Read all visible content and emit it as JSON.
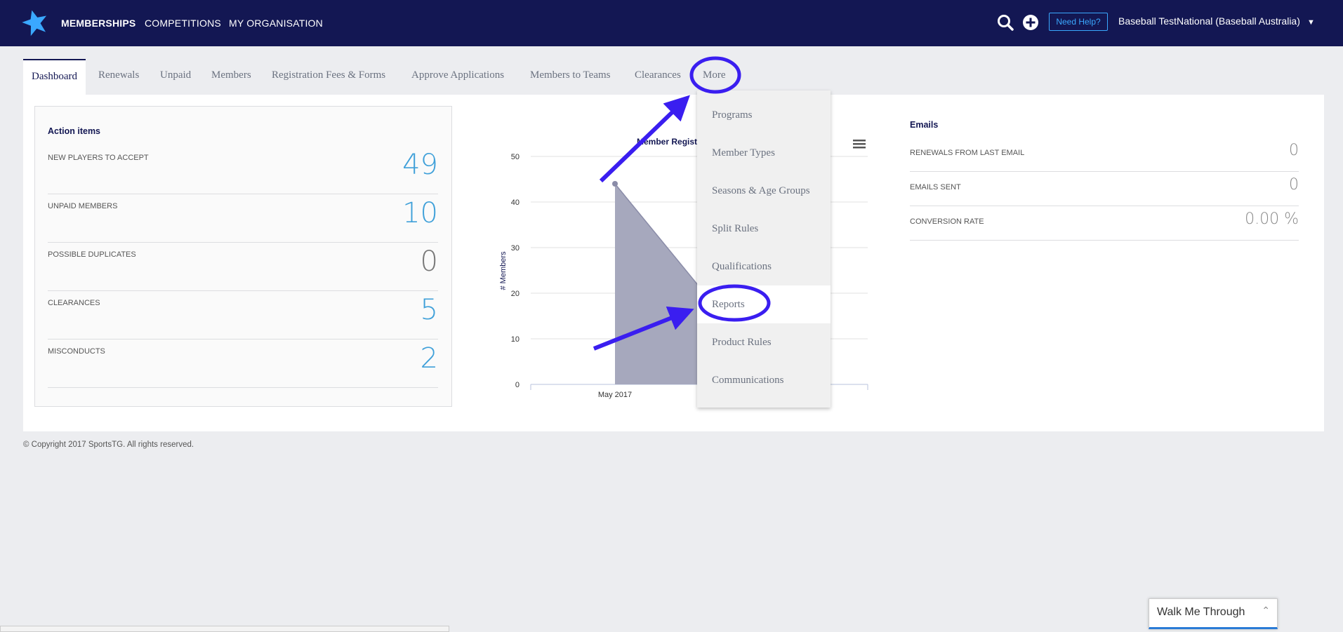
{
  "topbar": {
    "nav": [
      "MEMBERSHIPS",
      "COMPETITIONS",
      "MY ORGANISATION"
    ],
    "help_label": "Need Help?",
    "org_name": "Baseball TestNational (Baseball Australia)"
  },
  "tabs": [
    "Dashboard",
    "Renewals",
    "Unpaid",
    "Members",
    "Registration Fees & Forms",
    "Approve Applications",
    "Members to Teams",
    "Clearances",
    "More"
  ],
  "action_items": {
    "title": "Action items",
    "rows": [
      {
        "label": "NEW PLAYERS TO ACCEPT",
        "value": "49"
      },
      {
        "label": "UNPAID MEMBERS",
        "value": "10"
      },
      {
        "label": "POSSIBLE DUPLICATES",
        "value": "0"
      },
      {
        "label": "CLEARANCES",
        "value": "5"
      },
      {
        "label": "MISCONDUCTS",
        "value": "2"
      }
    ]
  },
  "chart_data": {
    "type": "area",
    "title": "Member Regist",
    "ylabel": "# Members",
    "ylim": [
      0,
      50
    ],
    "yticks": [
      "0",
      "10",
      "20",
      "30",
      "40",
      "50"
    ],
    "x": [
      "May 2017"
    ],
    "values": [
      44
    ],
    "color": "#a6a8bd"
  },
  "more_menu": [
    "Programs",
    "Member Types",
    "Seasons & Age Groups",
    "Split Rules",
    "Qualifications",
    "Reports",
    "Product Rules",
    "Communications"
  ],
  "emails": {
    "title": "Emails",
    "rows": [
      {
        "label": "RENEWALS FROM LAST EMAIL",
        "value": "0"
      },
      {
        "label": "EMAILS SENT",
        "value": "0"
      },
      {
        "label": "CONVERSION RATE",
        "value": "0.00 %"
      }
    ]
  },
  "footer": {
    "copyright": "© Copyright 2017 SportsTG. All rights reserved."
  },
  "walkme": {
    "label": "Walk Me Through"
  },
  "colors": {
    "navy": "#131753",
    "accent": "#3fa0d9",
    "annotation": "#3a1ef0"
  }
}
